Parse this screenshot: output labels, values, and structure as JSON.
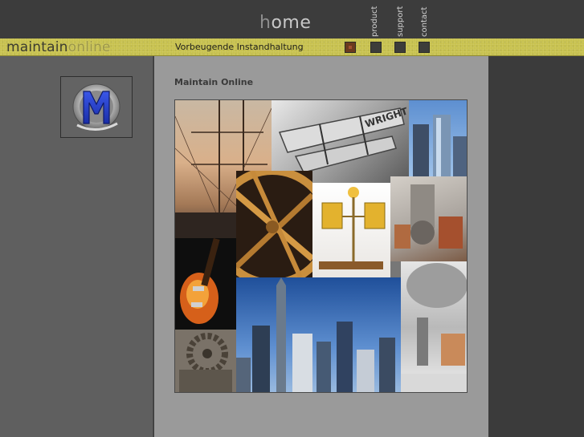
{
  "header": {
    "home_label_first": "h",
    "home_label_rest": "ome",
    "nav": [
      {
        "label": "product"
      },
      {
        "label": "support"
      },
      {
        "label": "contact"
      }
    ]
  },
  "band": {
    "logo_maintain": "maintain",
    "logo_online": "online",
    "tagline": "Vorbeugende Instandhaltung"
  },
  "sidebar": {
    "logo_letter": "M"
  },
  "main": {
    "title": "Maintain Online"
  },
  "colors": {
    "band": "#c8c24f",
    "left_column": "#5f5f5f",
    "main_column": "#9a9a9a",
    "right_column": "#3b3b3b",
    "active_square": "#6a3a1e"
  },
  "collage_images": [
    "sailing-ship",
    "wright-airplane",
    "skyscraper-towers",
    "wooden-wheel",
    "brass-instrument",
    "machine-parts",
    "electric-guitar",
    "city-skyline",
    "industrial-gears",
    "metal-machinery"
  ]
}
